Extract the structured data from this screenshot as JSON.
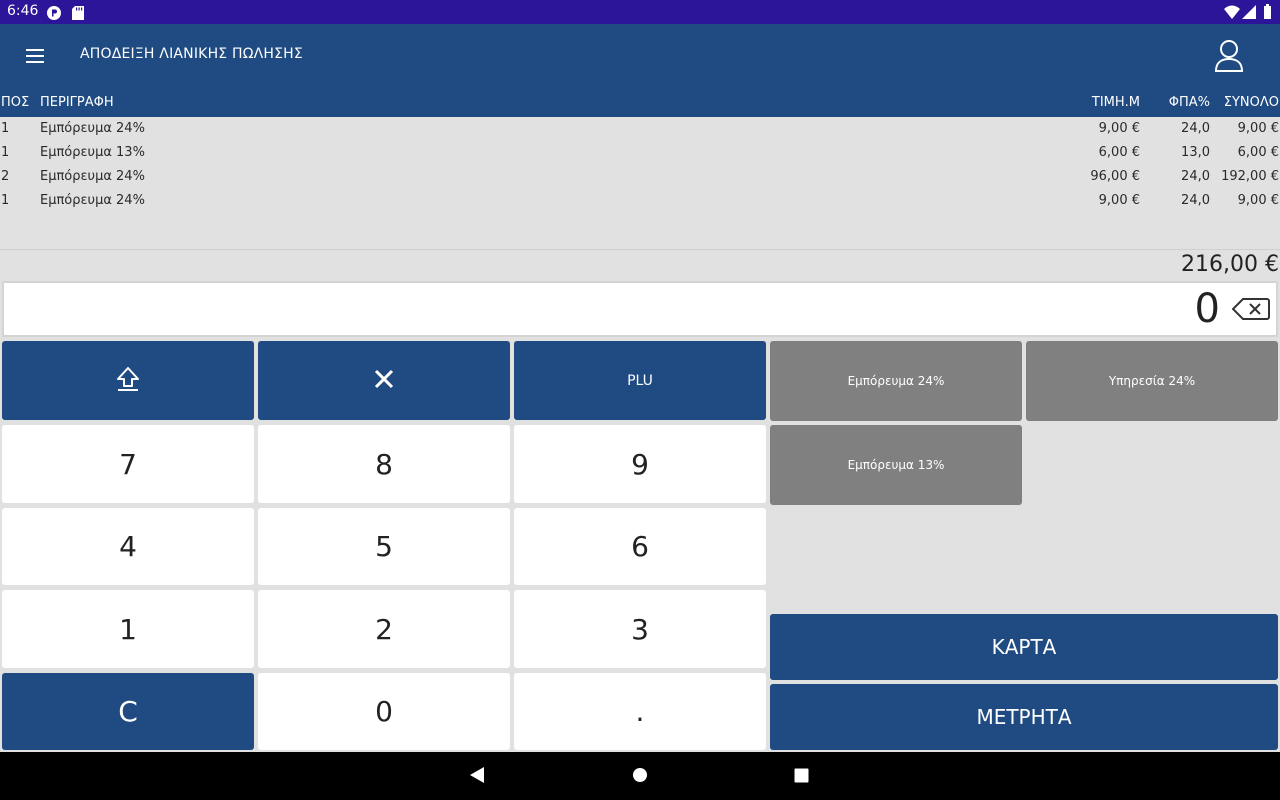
{
  "status_bar": {
    "time": "6:46"
  },
  "app_bar": {
    "title": "ΑΠΟΔΕΙΞΗ ΛΙΑΝΙΚΗΣ ΠΩΛΗΣΗΣ"
  },
  "table": {
    "headers": {
      "qty": "ΠΟΣ",
      "description": "ΠΕΡΙΓΡΑΦΗ",
      "unit_price": "ΤΙΜΗ.Μ",
      "vat": "ΦΠΑ%",
      "total": "ΣΥΝΟΛΟ"
    },
    "rows": [
      {
        "qty": "1",
        "description": "Εμπόρευμα 24%",
        "unit_price": "9,00 €",
        "vat": "24,0",
        "total": "9,00 €"
      },
      {
        "qty": "1",
        "description": "Εμπόρευμα 13%",
        "unit_price": "6,00 €",
        "vat": "13,0",
        "total": "6,00 €"
      },
      {
        "qty": "2",
        "description": "Εμπόρευμα 24%",
        "unit_price": "96,00 €",
        "vat": "24,0",
        "total": "192,00 €"
      },
      {
        "qty": "1",
        "description": "Εμπόρευμα 24%",
        "unit_price": "9,00 €",
        "vat": "24,0",
        "total": "9,00 €"
      }
    ]
  },
  "summary": {
    "total": "216,00 €"
  },
  "display": {
    "value": "0"
  },
  "keypad": {
    "plu": "PLU",
    "seven": "7",
    "eight": "8",
    "nine": "9",
    "four": "4",
    "five": "5",
    "six": "6",
    "one": "1",
    "two": "2",
    "three": "3",
    "clear": "C",
    "zero": "0",
    "dot": "."
  },
  "products": {
    "goods_24": "Εμπόρευμα 24%",
    "service_24": "Υπηρεσία 24%",
    "goods_13": "Εμπόρευμα 13%"
  },
  "payments": {
    "card": "ΚΑΡΤΑ",
    "cash": "ΜΕΤΡΗΤΑ"
  },
  "colors": {
    "primary": "#1f4b82",
    "status_bar": "#2c1598",
    "product_button": "#808080",
    "background": "#e1e1e1"
  }
}
